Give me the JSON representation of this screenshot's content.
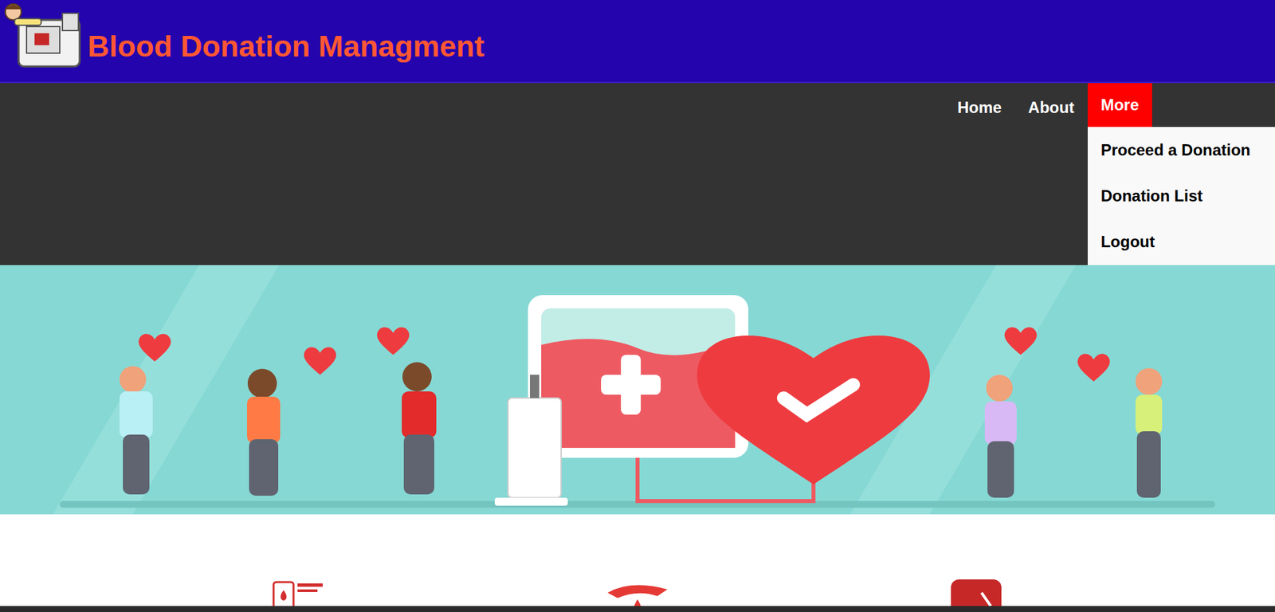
{
  "header": {
    "title": "Blood Donation Managment"
  },
  "nav": [
    {
      "label": "Home",
      "selected": false,
      "expanded": false
    },
    {
      "label": "About",
      "selected": false,
      "expanded": false
    },
    {
      "label": "More",
      "selected": true,
      "expanded": true
    }
  ],
  "dropdown": {
    "items": [
      "Proceed a Donation",
      "Donation List",
      "Logout"
    ]
  }
}
